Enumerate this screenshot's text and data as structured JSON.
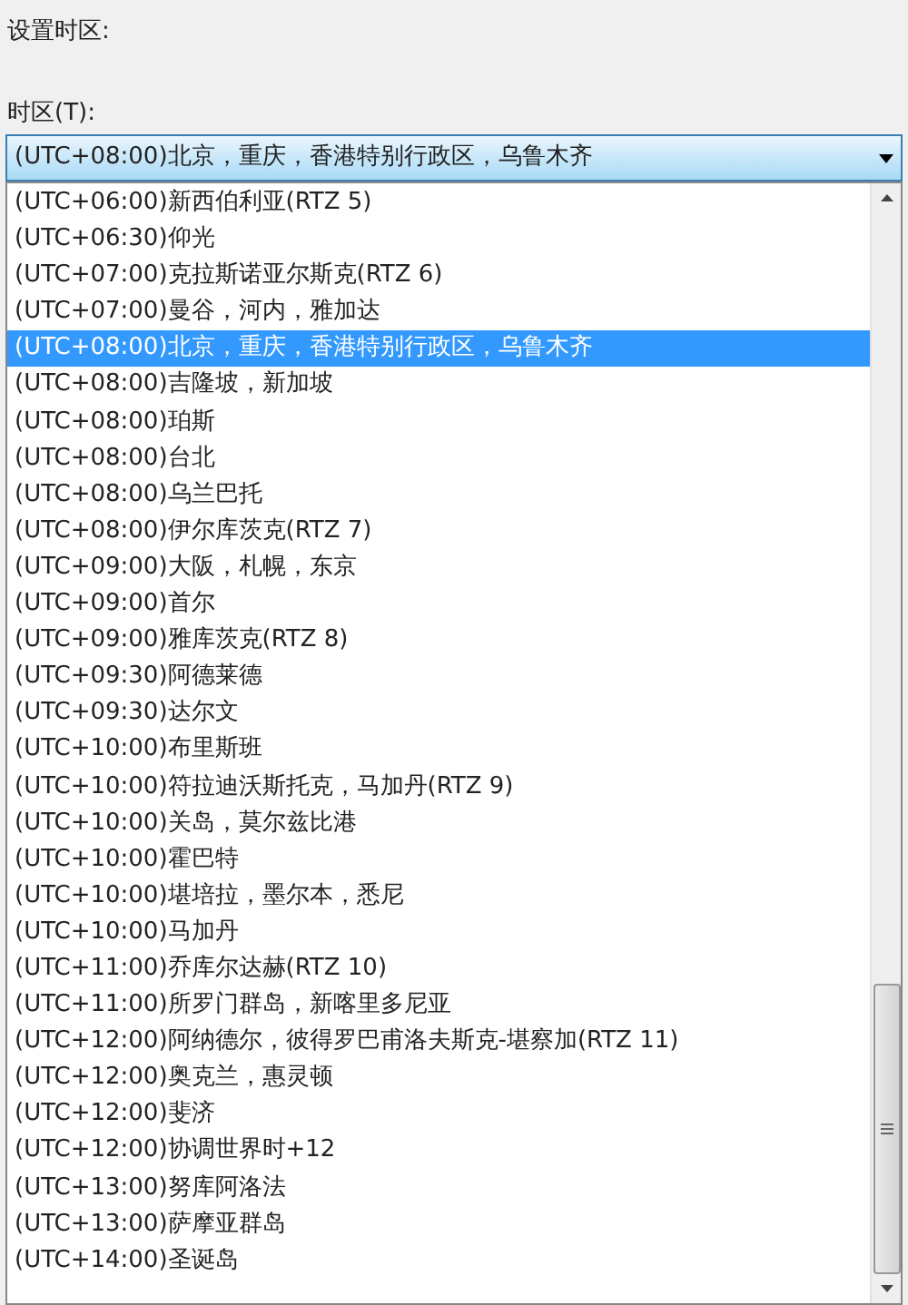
{
  "heading": "设置时区:",
  "timezone_field": {
    "label": "时区(T):",
    "value": "(UTC+08:00)北京，重庆，香港特别行政区，乌鲁木齐",
    "expanded": true
  },
  "options": [
    {
      "label": "(UTC+06:00)新西伯利亚(RTZ 5)",
      "selected": false
    },
    {
      "label": "(UTC+06:30)仰光",
      "selected": false
    },
    {
      "label": "(UTC+07:00)克拉斯诺亚尔斯克(RTZ 6)",
      "selected": false
    },
    {
      "label": "(UTC+07:00)曼谷，河内，雅加达",
      "selected": false
    },
    {
      "label": "(UTC+08:00)北京，重庆，香港特别行政区，乌鲁木齐",
      "selected": true
    },
    {
      "label": "(UTC+08:00)吉隆坡，新加坡",
      "selected": false
    },
    {
      "label": "(UTC+08:00)珀斯",
      "selected": false
    },
    {
      "label": "(UTC+08:00)台北",
      "selected": false
    },
    {
      "label": "(UTC+08:00)乌兰巴托",
      "selected": false
    },
    {
      "label": "(UTC+08:00)伊尔库茨克(RTZ 7)",
      "selected": false
    },
    {
      "label": "(UTC+09:00)大阪，札幌，东京",
      "selected": false
    },
    {
      "label": "(UTC+09:00)首尔",
      "selected": false
    },
    {
      "label": "(UTC+09:00)雅库茨克(RTZ 8)",
      "selected": false
    },
    {
      "label": "(UTC+09:30)阿德莱德",
      "selected": false
    },
    {
      "label": "(UTC+09:30)达尔文",
      "selected": false
    },
    {
      "label": "(UTC+10:00)布里斯班",
      "selected": false
    },
    {
      "label": "(UTC+10:00)符拉迪沃斯托克，马加丹(RTZ 9)",
      "selected": false
    },
    {
      "label": "(UTC+10:00)关岛，莫尔兹比港",
      "selected": false
    },
    {
      "label": "(UTC+10:00)霍巴特",
      "selected": false
    },
    {
      "label": "(UTC+10:00)堪培拉，墨尔本，悉尼",
      "selected": false
    },
    {
      "label": "(UTC+10:00)马加丹",
      "selected": false
    },
    {
      "label": "(UTC+11:00)乔库尔达赫(RTZ 10)",
      "selected": false
    },
    {
      "label": "(UTC+11:00)所罗门群岛，新喀里多尼亚",
      "selected": false
    },
    {
      "label": "(UTC+12:00)阿纳德尔，彼得罗巴甫洛夫斯克-堪察加(RTZ 11)",
      "selected": false
    },
    {
      "label": "(UTC+12:00)奥克兰，惠灵顿",
      "selected": false
    },
    {
      "label": "(UTC+12:00)斐济",
      "selected": false
    },
    {
      "label": "(UTC+12:00)协调世界时+12",
      "selected": false
    },
    {
      "label": "(UTC+13:00)努库阿洛法",
      "selected": false
    },
    {
      "label": "(UTC+13:00)萨摩亚群岛",
      "selected": false
    },
    {
      "label": "(UTC+14:00)圣诞岛",
      "selected": false
    }
  ]
}
